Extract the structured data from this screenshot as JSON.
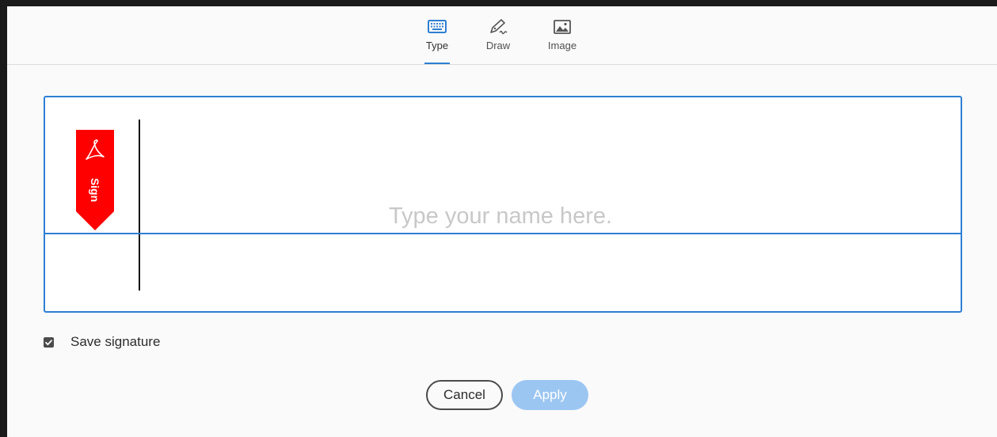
{
  "tabs": [
    {
      "label": "Type",
      "icon": "keyboard-icon",
      "active": true
    },
    {
      "label": "Draw",
      "icon": "pen-icon",
      "active": false
    },
    {
      "label": "Image",
      "icon": "image-icon",
      "active": false
    }
  ],
  "signature": {
    "placeholder": "Type your name here.",
    "value": "",
    "badge_text": "Sign",
    "badge_color": "#ff0000"
  },
  "save_signature": {
    "label": "Save signature",
    "checked": true
  },
  "buttons": {
    "cancel": "Cancel",
    "apply": "Apply"
  },
  "colors": {
    "accent": "#2d7fd3",
    "apply_disabled": "#9cc6f2"
  }
}
